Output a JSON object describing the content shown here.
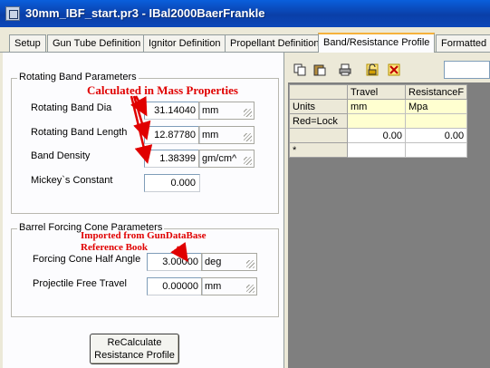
{
  "window": {
    "title": "30mm_IBF_start.pr3 - IBal2000BaerFrankle"
  },
  "tabs": [
    {
      "label": "Setup"
    },
    {
      "label": "Gun Tube Definition"
    },
    {
      "label": "Ignitor Definition"
    },
    {
      "label": "Propellant Definition"
    },
    {
      "label": "Band/Resistance Profile"
    },
    {
      "label": "Formatted F"
    }
  ],
  "rotating_band": {
    "legend": "Rotating Band Parameters",
    "dia_label": "Rotating Band Dia",
    "dia_value": "31.14040",
    "dia_unit": "mm",
    "length_label": "Rotating Band Length",
    "length_value": "12.87780",
    "length_unit": "mm",
    "density_label": "Band Density",
    "density_value": "1.38399",
    "density_unit": "gm/cm^",
    "mickey_label": "Mickey`s Constant",
    "mickey_value": "0.000"
  },
  "forcing_cone": {
    "legend": "Barrel Forcing Cone Parameters",
    "half_angle_label": "Forcing Cone Half Angle",
    "half_angle_value": "3.00000",
    "half_angle_unit": "deg",
    "free_travel_label": "Projectile Free Travel",
    "free_travel_value": "0.00000",
    "free_travel_unit": "mm"
  },
  "annotations": {
    "mass_props": "Calculated in Mass Properties",
    "gundb_line1": "Imported from GunDataBase",
    "gundb_line2": "Reference Book"
  },
  "recalc_button": {
    "line1": "ReCalculate",
    "line2": "Resistance Profile"
  },
  "grid": {
    "headers": [
      "",
      "Travel",
      "ResistanceF"
    ],
    "rows": [
      [
        "Units",
        "mm",
        "Mpa"
      ],
      [
        "Red=Lock",
        "",
        ""
      ],
      [
        "",
        "0.00",
        "0.00"
      ],
      [
        "*",
        "",
        ""
      ]
    ]
  },
  "colors": {
    "annotation": "#e00000",
    "titlebar": "#0a4fc8",
    "active_tab_accent": "#f6b23c"
  }
}
